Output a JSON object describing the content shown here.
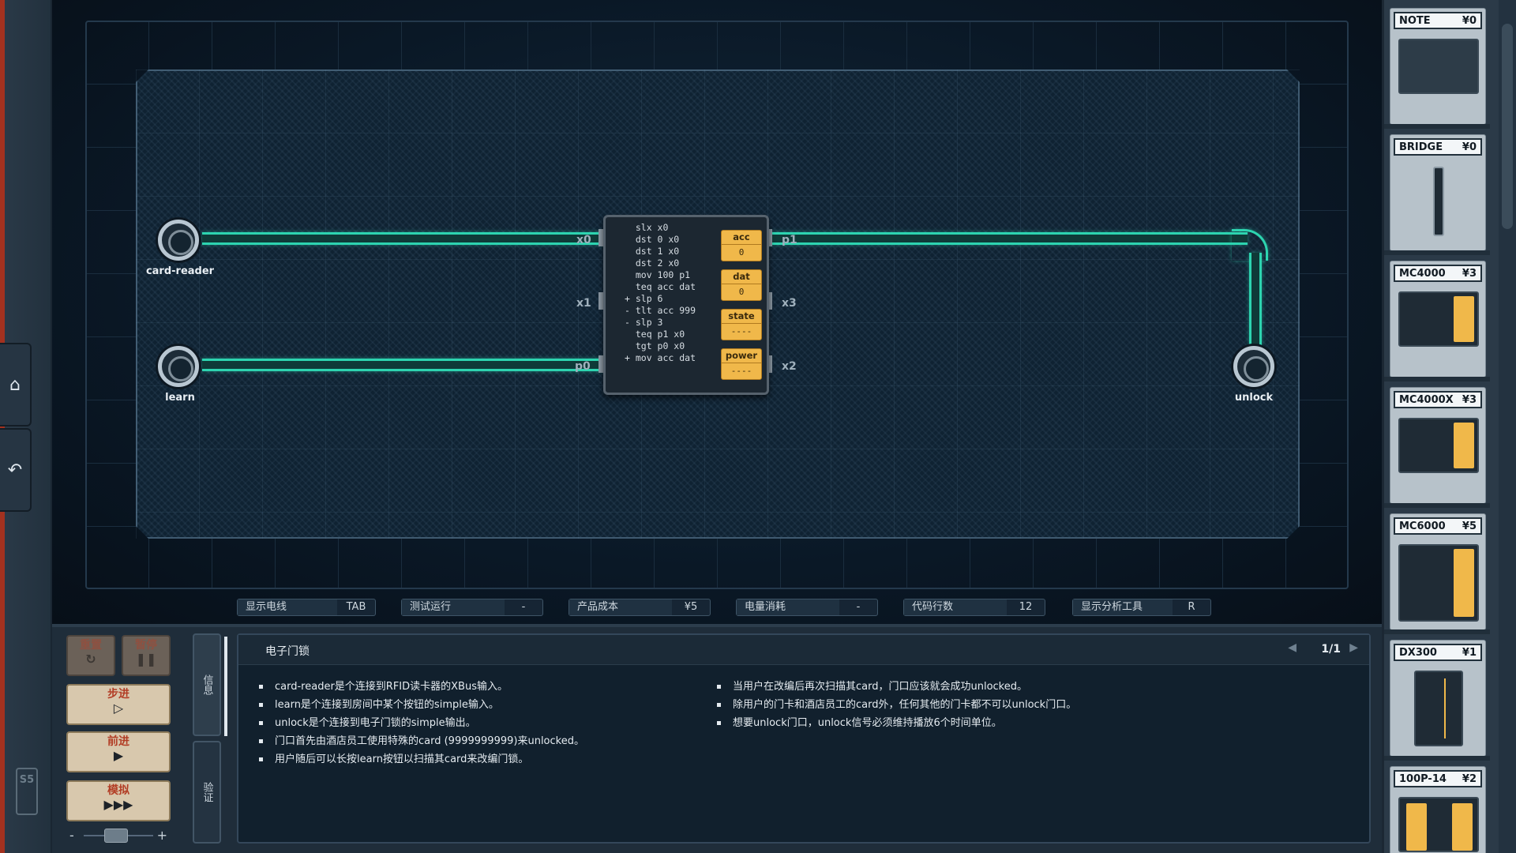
{
  "toolbar_left": {
    "home_icon": "home-icon",
    "undo_icon": "undo-icon",
    "logo_text": "S5"
  },
  "board": {
    "ports": {
      "card_reader": "card-reader",
      "learn": "learn",
      "unlock": "unlock"
    },
    "pins": {
      "x0": "x0",
      "x1": "x1",
      "p0": "p0",
      "p1": "p1",
      "x3": "x3",
      "x2": "x2"
    },
    "chip": {
      "code": "  slx x0\n  dst 0 x0\n  dst 1 x0\n  dst 2 x0\n  mov 100 p1\n  teq acc dat\n+ slp 6\n- tlt acc 999\n- slp 3\n  teq p1 x0\n  tgt p0 x0\n+ mov acc dat",
      "registers": [
        {
          "label": "acc",
          "value": "0"
        },
        {
          "label": "dat",
          "value": "0"
        },
        {
          "label": "state",
          "value": "----"
        },
        {
          "label": "power",
          "value": "----"
        }
      ]
    }
  },
  "statusbar": [
    {
      "label": "显示电线",
      "value": "TAB"
    },
    {
      "label": "测试运行",
      "value": "-"
    },
    {
      "label": "产品成本",
      "value": "¥5"
    },
    {
      "label": "电量消耗",
      "value": "-"
    },
    {
      "label": "代码行数",
      "value": "12"
    },
    {
      "label": "显示分析工具",
      "value": "R"
    }
  ],
  "parts": [
    {
      "name": "NOTE",
      "price": "¥0"
    },
    {
      "name": "BRIDGE",
      "price": "¥0"
    },
    {
      "name": "MC4000",
      "price": "¥3"
    },
    {
      "name": "MC4000X",
      "price": "¥3"
    },
    {
      "name": "MC6000",
      "price": "¥5"
    },
    {
      "name": "DX300",
      "price": "¥1"
    },
    {
      "name": "100P-14",
      "price": "¥2"
    }
  ],
  "controls": {
    "reset": "重置",
    "pause": "暂停",
    "step": "步进",
    "forward": "前进",
    "simulate": "模拟",
    "speed_minus": "-",
    "speed_plus": "+"
  },
  "tabs": {
    "info": "信息",
    "verify": "验证"
  },
  "info": {
    "title": "电子门锁",
    "page": "1/1",
    "left_bullets": [
      "card-reader是个连接到RFID读卡器的XBus输入。",
      "learn是个连接到房间中某个按钮的simple输入。",
      "unlock是个连接到电子门锁的simple输出。",
      "门口首先由酒店员工使用特殊的card (9999999999)来unlocked。",
      "用户随后可以长按learn按钮以扫描其card来改编门锁。"
    ],
    "right_bullets": [
      "当用户在改编后再次扫描其card，门口应该就会成功unlocked。",
      "除用户的门卡和酒店员工的card外，任何其他的门卡都不可以unlock门口。",
      "想要unlock门口，unlock信号必须维持播放6个时间单位。"
    ]
  }
}
